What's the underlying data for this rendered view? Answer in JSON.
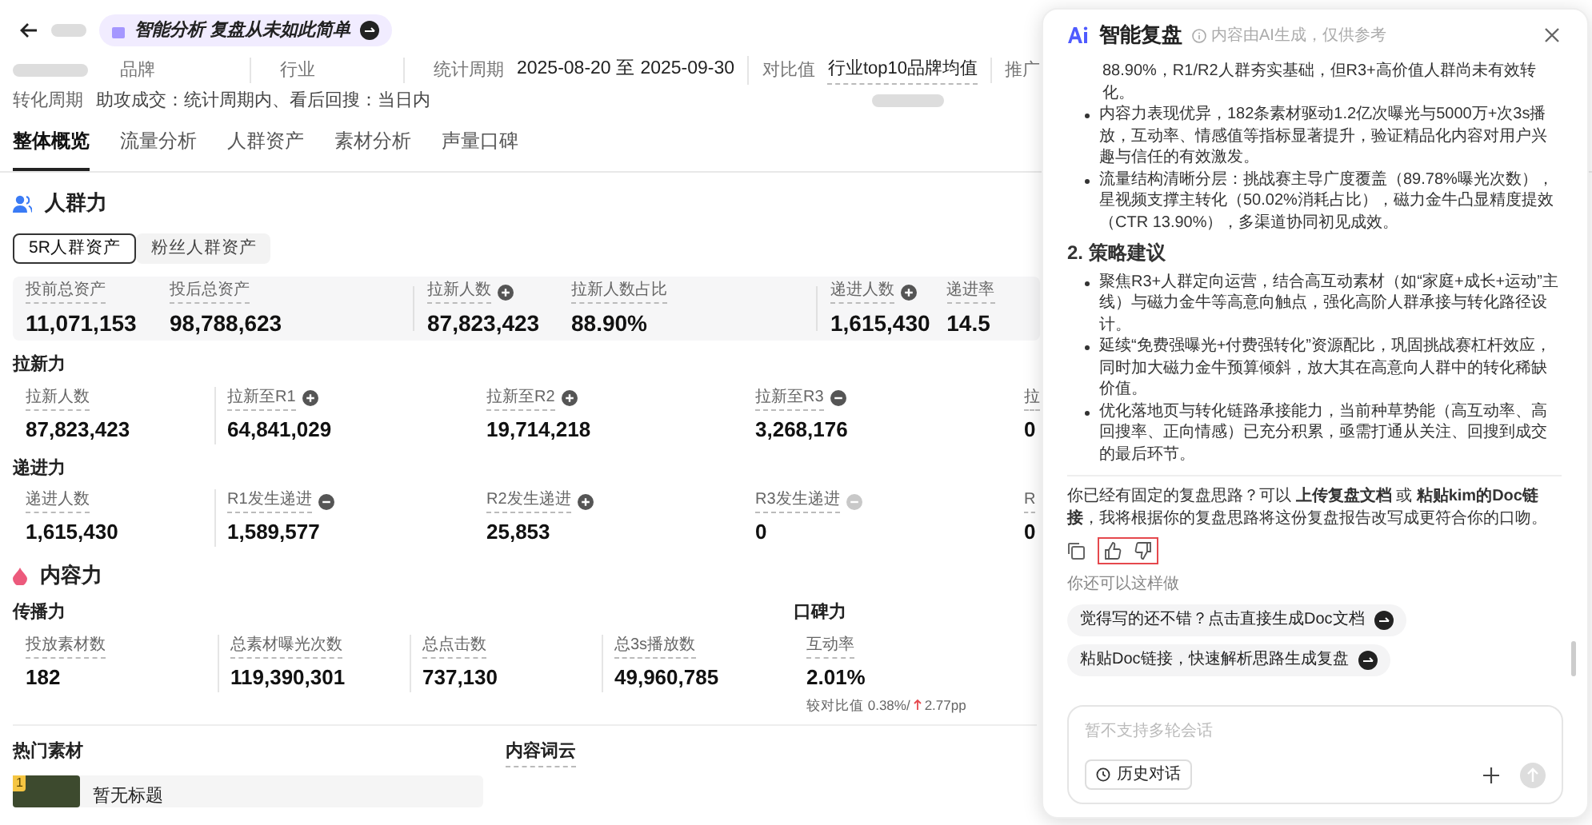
{
  "header": {
    "badge": "智能分析 复盘从未如此简单"
  },
  "meta": {
    "row_1": [
      {
        "label": "品牌"
      },
      {
        "label": "行业"
      },
      {
        "label": "统计周期",
        "value": "2025-08-20 至 2025-09-30"
      }
    ],
    "compare": {
      "label": "对比值",
      "value": "行业top10品牌均值"
    },
    "channel_label": "推广",
    "row_2": {
      "label": "转化周期",
      "value": "助攻成交：统计周期内、看后回搜：当日内"
    }
  },
  "tabs": [
    {
      "label": "整体概览",
      "selected": true
    },
    {
      "label": "流量分析",
      "selected": false
    },
    {
      "label": "人群资产",
      "selected": false
    },
    {
      "label": "素材分析",
      "selected": false
    },
    {
      "label": "声量口碑",
      "selected": false
    }
  ],
  "audience": {
    "title": "人群力",
    "segments": [
      {
        "label": "5R人群资产",
        "selected": true
      },
      {
        "label": "粉丝人群资产",
        "selected": false
      }
    ],
    "summary": [
      [
        {
          "label": "投前总资产",
          "value": "11,071,153",
          "kind": "plain"
        },
        {
          "label": "投后总资产",
          "value": "98,788,623",
          "kind": "plain"
        }
      ],
      [
        {
          "label": "拉新人数",
          "value": "87,823,423",
          "kind": "plus"
        },
        {
          "label": "拉新人数占比",
          "value": "88.90%",
          "kind": "plain"
        }
      ],
      [
        {
          "label": "递进人数",
          "value": "1,615,430",
          "kind": "plus"
        },
        {
          "label": "递进率",
          "value": "14.5",
          "kind": "plain"
        }
      ]
    ],
    "groups": [
      {
        "title": "拉新力",
        "metrics": [
          {
            "label": "拉新人数",
            "value": "87,823,423",
            "kind": "plain"
          },
          {
            "label": "拉新至R1",
            "value": "64,841,029",
            "kind": "plus"
          },
          {
            "label": "拉新至R2",
            "value": "19,714,218",
            "kind": "plus"
          },
          {
            "label": "拉新至R3",
            "value": "3,268,176",
            "kind": "minus"
          },
          {
            "label": "拉",
            "value": "0",
            "kind": "plain"
          }
        ]
      },
      {
        "title": "递进力",
        "metrics": [
          {
            "label": "递进人数",
            "value": "1,615,430",
            "kind": "plain"
          },
          {
            "label": "R1发生递进",
            "value": "1,589,577",
            "kind": "minus"
          },
          {
            "label": "R2发生递进",
            "value": "25,853",
            "kind": "plus"
          },
          {
            "label": "R3发生递进",
            "value": "0",
            "kind": "faint"
          },
          {
            "label": "R",
            "value": "0",
            "kind": "plain"
          }
        ]
      }
    ]
  },
  "content": {
    "title": "内容力",
    "spread": {
      "title": "传播力",
      "metrics": [
        {
          "label": "投放素材数",
          "value": "182"
        },
        {
          "label": "总素材曝光次数",
          "value": "119,390,301"
        },
        {
          "label": "总点击数",
          "value": "737,130"
        },
        {
          "label": "总3s播放数",
          "value": "49,960,785"
        }
      ]
    },
    "reputation": {
      "title": "口碑力",
      "metric": {
        "label": "互动率",
        "value": "2.01%",
        "compare_label": "较对比值 0.38%/",
        "delta": "2.77pp"
      }
    },
    "hot_title": "热门素材",
    "hot_items": [
      {
        "rank": "1",
        "title": "暂无标题"
      }
    ],
    "cloud_title": "内容词云"
  },
  "panel": {
    "title": "智能复盘",
    "note": "内容由AI生成，仅供参考",
    "lead": "88.90%，R1/R2人群夯实基础，但R3+高价值人群尚未有效转化。",
    "bullets_1": [
      "内容力表现优异，182条素材驱动1.2亿次曝光与5000万+次3s播放，互动率、情感值等指标显著提升，验证精品化内容对用户兴趣与信任的有效激发。",
      "流量结构清晰分层：挑战赛主导广度覆盖（89.78%曝光次数），星视频支撑主转化（50.02%消耗占比），磁力金牛凸显精度提效（CTR 13.90%），多渠道协同初见成效。"
    ],
    "heading": "2. 策略建议",
    "bullets_2": [
      "聚焦R3+人群定向运营，结合高互动素材（如“家庭+成长+运动”主线）与磁力金牛等高意向触点，强化高阶人群承接与转化路径设计。",
      "延续“免费强曝光+付费强转化”资源配比，巩固挑战赛杠杆效应，同时加大磁力金牛预算倾斜，放大其在高意向人群中的转化稀缺价值。",
      "优化落地页与转化链路承接能力，当前种草势能（高互动率、高回搜率、正向情感）已充分积累，亟需打通从关注、回搜到成交的最后环节。"
    ],
    "prompt": "你已经有固定的复盘思路？可以 **上传复盘文档** 或 **粘贴kim的Doc链接**，我将根据你的复盘思路将这份复盘报告改写成更符合你的口吻。",
    "suggest_title": "你还可以这样做",
    "suggestions": [
      "觉得写的还不错？点击直接生成Doc文档",
      "粘贴Doc链接，快速解析思路生成复盘"
    ],
    "input": {
      "placeholder": "暂不支持多轮会话"
    },
    "history_button": "历史对话"
  }
}
